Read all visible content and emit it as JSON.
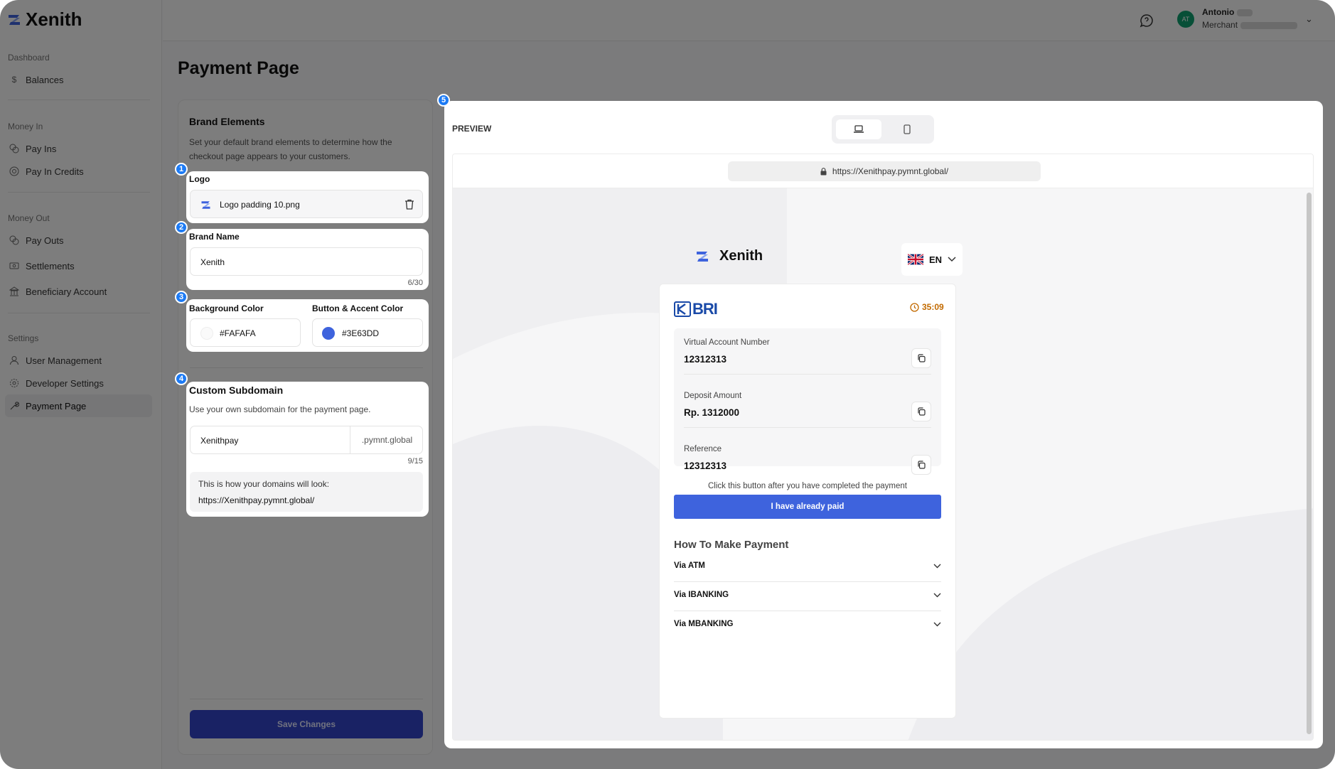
{
  "app": {
    "name": "Xenith"
  },
  "sidebar": {
    "sections": [
      {
        "title": "Dashboard",
        "items": [
          {
            "label": "Balances",
            "icon": "dollar-icon"
          }
        ]
      },
      {
        "title": "Money In",
        "items": [
          {
            "label": "Pay Ins",
            "icon": "coins-icon"
          },
          {
            "label": "Pay In Credits",
            "icon": "credit-circle-icon"
          }
        ]
      },
      {
        "title": "Money Out",
        "items": [
          {
            "label": "Pay Outs",
            "icon": "coins-icon"
          },
          {
            "label": "Settlements",
            "icon": "cash-icon"
          },
          {
            "label": "Beneficiary Account",
            "icon": "bank-icon"
          }
        ]
      },
      {
        "title": "Settings",
        "items": [
          {
            "label": "User Management",
            "icon": "user-icon"
          },
          {
            "label": "Developer Settings",
            "icon": "gear-icon"
          },
          {
            "label": "Payment Page",
            "icon": "wrench-icon",
            "active": true
          }
        ]
      }
    ]
  },
  "user": {
    "name": "Antonio",
    "role": "Merchant",
    "initials": "AT"
  },
  "page": {
    "title": "Payment Page"
  },
  "brand": {
    "title": "Brand Elements",
    "description": "Set your default brand elements to determine how the checkout page appears to your customers.",
    "logo": {
      "label": "Logo",
      "file_name": "Logo padding 10.png"
    },
    "brand_name": {
      "label": "Brand Name",
      "value": "Xenith",
      "counter": "6/30"
    },
    "background_color": {
      "label": "Background Color",
      "value": "#FAFAFA"
    },
    "accent_color": {
      "label": "Button & Accent Color",
      "value": "#3E63DD"
    },
    "subdomain": {
      "title": "Custom Subdomain",
      "description": "Use your own subdomain for the payment page.",
      "value": "Xenithpay",
      "suffix": ".pymnt.global",
      "counter": "9/15",
      "preview_label": "This is how your domains will look:",
      "preview_url": "https://Xenithpay.pymnt.global/"
    },
    "save_label": "Save Changes"
  },
  "badges": [
    "1",
    "2",
    "3",
    "4",
    "5"
  ],
  "preview": {
    "label": "PREVIEW",
    "url": "https://Xenithpay.pymnt.global/",
    "merchant": "Xenith",
    "language": "EN",
    "bank": "BRI",
    "timer": "35:09",
    "fields": [
      {
        "label": "Virtual Account Number",
        "value": "12312313"
      },
      {
        "label": "Deposit Amount",
        "value": "Rp. 1312000"
      },
      {
        "label": "Reference",
        "value": "12312313"
      }
    ],
    "note": "Click this button after you have completed the payment",
    "paid_button": "I have already paid",
    "how_title": "How To Make Payment",
    "methods": [
      "Via ATM",
      "Via IBANKING",
      "Via MBANKING"
    ]
  },
  "colors": {
    "accent": "#3E63DD",
    "badge": "#1D7BF5",
    "save": "#3344C8"
  }
}
